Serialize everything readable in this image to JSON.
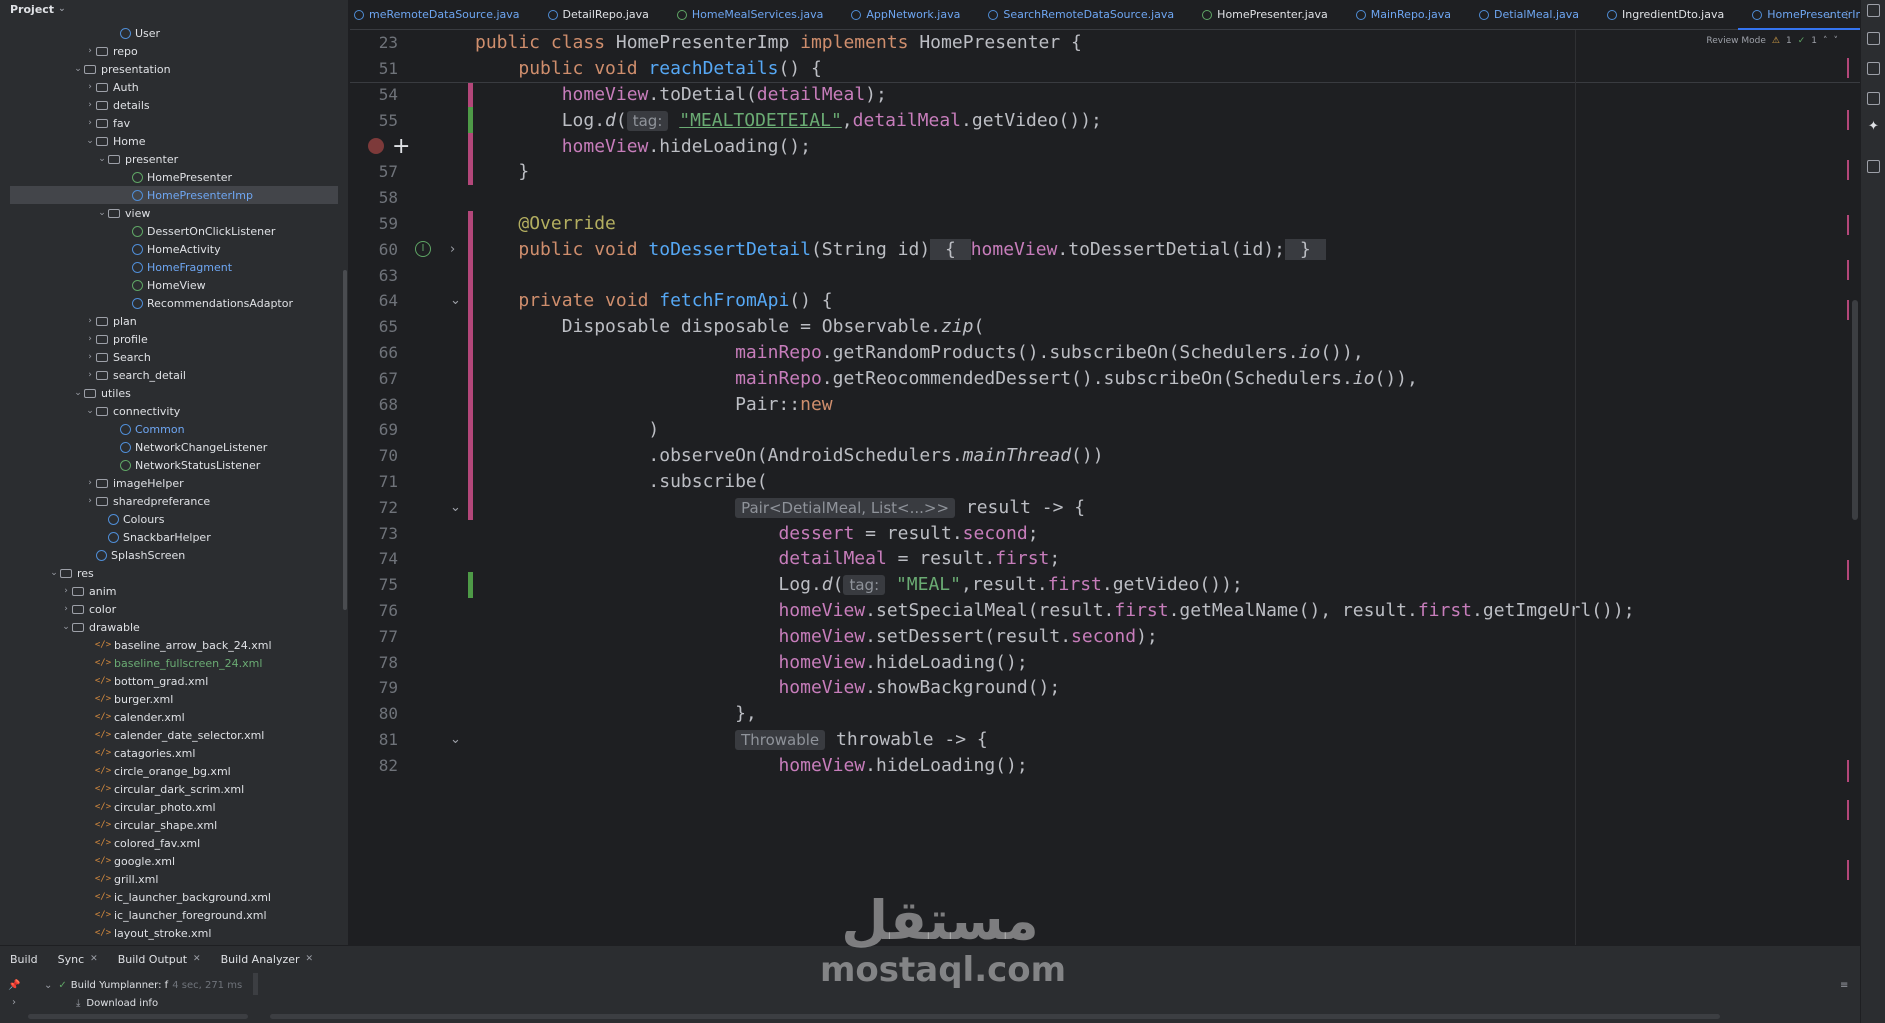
{
  "project_panel": {
    "title": "Project",
    "tree": [
      {
        "label": "User",
        "depth": 9,
        "icon": "class-icon",
        "color": "",
        "arrow": ""
      },
      {
        "label": "repo",
        "depth": 7,
        "icon": "folder-icon",
        "color": "",
        "arrow": "right"
      },
      {
        "label": "presentation",
        "depth": 6,
        "icon": "folder-icon",
        "color": "",
        "arrow": "down"
      },
      {
        "label": "Auth",
        "depth": 7,
        "icon": "folder-icon",
        "color": "",
        "arrow": "right"
      },
      {
        "label": "details",
        "depth": 7,
        "icon": "folder-icon",
        "color": "",
        "arrow": "right"
      },
      {
        "label": "fav",
        "depth": 7,
        "icon": "folder-icon",
        "color": "",
        "arrow": "right"
      },
      {
        "label": "Home",
        "depth": 7,
        "icon": "folder-icon",
        "color": "",
        "arrow": "down"
      },
      {
        "label": "presenter",
        "depth": 8,
        "icon": "folder-icon",
        "color": "",
        "arrow": "down"
      },
      {
        "label": "HomePresenter",
        "depth": 10,
        "icon": "interface-icon",
        "color": "",
        "arrow": ""
      },
      {
        "label": "HomePresenterImp",
        "depth": 10,
        "icon": "class-icon",
        "color": "blue",
        "arrow": "",
        "selected": true
      },
      {
        "label": "view",
        "depth": 8,
        "icon": "folder-icon",
        "color": "",
        "arrow": "down"
      },
      {
        "label": "DessertOnClickListener",
        "depth": 10,
        "icon": "interface-icon",
        "color": "",
        "arrow": ""
      },
      {
        "label": "HomeActivity",
        "depth": 10,
        "icon": "class-icon",
        "color": "",
        "arrow": ""
      },
      {
        "label": "HomeFragment",
        "depth": 10,
        "icon": "class-icon",
        "color": "blue",
        "arrow": ""
      },
      {
        "label": "HomeView",
        "depth": 10,
        "icon": "interface-icon",
        "color": "",
        "arrow": ""
      },
      {
        "label": "RecommendationsAdaptor",
        "depth": 10,
        "icon": "class-icon",
        "color": "",
        "arrow": ""
      },
      {
        "label": "plan",
        "depth": 7,
        "icon": "folder-icon",
        "color": "",
        "arrow": "right"
      },
      {
        "label": "profile",
        "depth": 7,
        "icon": "folder-icon",
        "color": "",
        "arrow": "right"
      },
      {
        "label": "Search",
        "depth": 7,
        "icon": "folder-icon",
        "color": "",
        "arrow": "right"
      },
      {
        "label": "search_detail",
        "depth": 7,
        "icon": "folder-icon",
        "color": "",
        "arrow": "right"
      },
      {
        "label": "utiles",
        "depth": 6,
        "icon": "folder-icon",
        "color": "",
        "arrow": "down"
      },
      {
        "label": "connectivity",
        "depth": 7,
        "icon": "folder-icon",
        "color": "",
        "arrow": "down"
      },
      {
        "label": "Common",
        "depth": 9,
        "icon": "class-icon",
        "color": "blue",
        "arrow": ""
      },
      {
        "label": "NetworkChangeListener",
        "depth": 9,
        "icon": "class-icon",
        "color": "",
        "arrow": ""
      },
      {
        "label": "NetworkStatusListener",
        "depth": 9,
        "icon": "interface-icon",
        "color": "",
        "arrow": ""
      },
      {
        "label": "imageHelper",
        "depth": 7,
        "icon": "folder-icon",
        "color": "",
        "arrow": "right"
      },
      {
        "label": "sharedpreferance",
        "depth": 7,
        "icon": "folder-icon",
        "color": "",
        "arrow": "right"
      },
      {
        "label": "Colours",
        "depth": 8,
        "icon": "class-icon",
        "color": "",
        "arrow": ""
      },
      {
        "label": "SnackbarHelper",
        "depth": 8,
        "icon": "class-icon",
        "color": "",
        "arrow": ""
      },
      {
        "label": "SplashScreen",
        "depth": 7,
        "icon": "class-icon",
        "color": "",
        "arrow": ""
      },
      {
        "label": "res",
        "depth": 4,
        "icon": "folder-icon",
        "color": "",
        "arrow": "down"
      },
      {
        "label": "anim",
        "depth": 5,
        "icon": "folder-icon",
        "color": "",
        "arrow": "right"
      },
      {
        "label": "color",
        "depth": 5,
        "icon": "folder-icon",
        "color": "",
        "arrow": "right"
      },
      {
        "label": "drawable",
        "depth": 5,
        "icon": "folder-icon",
        "color": "",
        "arrow": "down"
      },
      {
        "label": "baseline_arrow_back_24.xml",
        "depth": 7,
        "icon": "xml-icon",
        "color": "",
        "arrow": ""
      },
      {
        "label": "baseline_fullscreen_24.xml",
        "depth": 7,
        "icon": "xml-icon",
        "color": "green",
        "arrow": ""
      },
      {
        "label": "bottom_grad.xml",
        "depth": 7,
        "icon": "xml-icon",
        "color": "",
        "arrow": ""
      },
      {
        "label": "burger.xml",
        "depth": 7,
        "icon": "xml-icon",
        "color": "",
        "arrow": ""
      },
      {
        "label": "calender.xml",
        "depth": 7,
        "icon": "xml-icon",
        "color": "",
        "arrow": ""
      },
      {
        "label": "calender_date_selector.xml",
        "depth": 7,
        "icon": "xml-icon",
        "color": "",
        "arrow": ""
      },
      {
        "label": "catagories.xml",
        "depth": 7,
        "icon": "xml-icon",
        "color": "",
        "arrow": ""
      },
      {
        "label": "circle_orange_bg.xml",
        "depth": 7,
        "icon": "xml-icon",
        "color": "",
        "arrow": ""
      },
      {
        "label": "circular_dark_scrim.xml",
        "depth": 7,
        "icon": "xml-icon",
        "color": "",
        "arrow": ""
      },
      {
        "label": "circular_photo.xml",
        "depth": 7,
        "icon": "xml-icon",
        "color": "",
        "arrow": ""
      },
      {
        "label": "circular_shape.xml",
        "depth": 7,
        "icon": "xml-icon",
        "color": "",
        "arrow": ""
      },
      {
        "label": "colored_fav.xml",
        "depth": 7,
        "icon": "xml-icon",
        "color": "",
        "arrow": ""
      },
      {
        "label": "google.xml",
        "depth": 7,
        "icon": "xml-icon",
        "color": "",
        "arrow": ""
      },
      {
        "label": "grill.xml",
        "depth": 7,
        "icon": "xml-icon",
        "color": "",
        "arrow": ""
      },
      {
        "label": "ic_launcher_background.xml",
        "depth": 7,
        "icon": "xml-icon",
        "color": "",
        "arrow": ""
      },
      {
        "label": "ic_launcher_foreground.xml",
        "depth": 7,
        "icon": "xml-icon",
        "color": "",
        "arrow": ""
      },
      {
        "label": "layout_stroke.xml",
        "depth": 7,
        "icon": "xml-icon",
        "color": "",
        "arrow": ""
      }
    ]
  },
  "editor": {
    "tabs": [
      {
        "label": "meRemoteDataSource.java",
        "kind": "class",
        "color": "blue"
      },
      {
        "label": "DetailRepo.java",
        "kind": "class",
        "color": "plain"
      },
      {
        "label": "HomeMealServices.java",
        "kind": "interface",
        "color": "blue"
      },
      {
        "label": "AppNetwork.java",
        "kind": "class",
        "color": "blue"
      },
      {
        "label": "SearchRemoteDataSource.java",
        "kind": "class",
        "color": "blue"
      },
      {
        "label": "HomePresenter.java",
        "kind": "interface",
        "color": "plain"
      },
      {
        "label": "MainRepo.java",
        "kind": "class",
        "color": "blue"
      },
      {
        "label": "DetialMeal.java",
        "kind": "class",
        "color": "blue"
      },
      {
        "label": "IngredientDto.java",
        "kind": "class",
        "color": "plain"
      },
      {
        "label": "HomePresenterImp.java",
        "kind": "class",
        "color": "blue",
        "active": true
      }
    ],
    "review_mode_label": "Review Mode",
    "warning_count": "1",
    "ok_count": "1",
    "lines": [
      {
        "n": "23",
        "sticky": true,
        "tokens": [
          [
            "kw",
            "public class "
          ],
          [
            "",
            "HomePresenterImp "
          ],
          [
            "kw",
            "implements "
          ],
          [
            "",
            "HomePresenter {"
          ]
        ]
      },
      {
        "n": "51",
        "sticky": true,
        "tokens": [
          [
            "",
            "    "
          ],
          [
            "kw",
            "public void "
          ],
          [
            "fn",
            "reachDetails"
          ],
          [
            "",
            "() {"
          ]
        ]
      },
      {
        "n": "54",
        "bar": "pink",
        "tokens": [
          [
            "",
            "        "
          ],
          [
            "fld",
            "homeView"
          ],
          [
            "",
            ".toDetial("
          ],
          [
            "fld",
            "detailMeal"
          ],
          [
            "",
            ");"
          ]
        ]
      },
      {
        "n": "55",
        "bar": "green",
        "tokens": [
          [
            "",
            "        Log."
          ],
          [
            "it",
            "d"
          ],
          [
            "",
            "("
          ],
          [
            "hint",
            "tag:"
          ],
          [
            "str",
            " "
          ],
          [
            "str ul",
            "\"MEALTODETEIAL\""
          ],
          [
            "",
            ","
          ],
          [
            "fld",
            "detailMeal"
          ],
          [
            "",
            ".getVideo());"
          ]
        ]
      },
      {
        "n": "",
        "bar": "pink",
        "breakpoint": true,
        "tokens": [
          [
            "",
            "        "
          ],
          [
            "fld",
            "homeView"
          ],
          [
            "",
            ".hideLoading();"
          ]
        ]
      },
      {
        "n": "57",
        "bar": "pink",
        "tokens": [
          [
            "",
            "    }"
          ]
        ]
      },
      {
        "n": "58",
        "tokens": [
          [
            "",
            ""
          ]
        ]
      },
      {
        "n": "59",
        "bar": "pink",
        "tokens": [
          [
            "",
            "    "
          ],
          [
            "ann",
            "@Override"
          ]
        ]
      },
      {
        "n": "60",
        "bar": "pink",
        "override": true,
        "fold": "›",
        "tokens": [
          [
            "",
            "    "
          ],
          [
            "kw",
            "public void "
          ],
          [
            "fn",
            "toDessertDetail"
          ],
          [
            "",
            "(String id)"
          ],
          [
            "fold-box",
            " { "
          ],
          [
            "fld",
            "homeView"
          ],
          [
            "",
            ".toDessertDetial(id);"
          ],
          [
            "fold-box",
            " } "
          ]
        ]
      },
      {
        "n": "63",
        "bar": "pink",
        "tokens": [
          [
            "",
            ""
          ]
        ]
      },
      {
        "n": "64",
        "bar": "pink",
        "fold": "⌄",
        "tokens": [
          [
            "",
            "    "
          ],
          [
            "kw",
            "private void "
          ],
          [
            "fn",
            "fetchFromApi"
          ],
          [
            "",
            "() {"
          ]
        ]
      },
      {
        "n": "65",
        "bar": "pink",
        "tokens": [
          [
            "",
            "        Disposable disposable = Observable."
          ],
          [
            "it",
            "zip"
          ],
          [
            "",
            "("
          ]
        ]
      },
      {
        "n": "66",
        "bar": "pink",
        "tokens": [
          [
            "",
            "                        "
          ],
          [
            "fld",
            "mainRepo"
          ],
          [
            "",
            ".getRandomProducts().subscribeOn(Schedulers."
          ],
          [
            "it",
            "io"
          ],
          [
            "",
            "()),"
          ]
        ]
      },
      {
        "n": "67",
        "bar": "pink",
        "tokens": [
          [
            "",
            "                        "
          ],
          [
            "fld",
            "mainRepo"
          ],
          [
            "",
            ".getReocommendedDessert().subscribeOn(Schedulers."
          ],
          [
            "it",
            "io"
          ],
          [
            "",
            "()),"
          ]
        ]
      },
      {
        "n": "68",
        "bar": "pink",
        "tokens": [
          [
            "",
            "                        Pair::"
          ],
          [
            "kw",
            "new"
          ]
        ]
      },
      {
        "n": "69",
        "bar": "pink",
        "tokens": [
          [
            "",
            "                )"
          ]
        ]
      },
      {
        "n": "70",
        "bar": "pink",
        "tokens": [
          [
            "",
            "                .observeOn(AndroidSchedulers."
          ],
          [
            "it",
            "mainThread"
          ],
          [
            "",
            "())"
          ]
        ]
      },
      {
        "n": "71",
        "bar": "pink",
        "tokens": [
          [
            "",
            "                .subscribe("
          ]
        ]
      },
      {
        "n": "72",
        "bar": "pink",
        "fold": "⌄",
        "tokens": [
          [
            "",
            "                        "
          ],
          [
            "hint",
            "Pair<DetialMeal, List<...>>"
          ],
          [
            "",
            " result -> {"
          ]
        ]
      },
      {
        "n": "73",
        "tokens": [
          [
            "",
            "                            "
          ],
          [
            "fld",
            "dessert"
          ],
          [
            "",
            " = result."
          ],
          [
            "fld",
            "second"
          ],
          [
            "",
            ";"
          ]
        ]
      },
      {
        "n": "74",
        "tokens": [
          [
            "",
            "                            "
          ],
          [
            "fld",
            "detailMeal"
          ],
          [
            "",
            " = result."
          ],
          [
            "fld",
            "first"
          ],
          [
            "",
            ";"
          ]
        ]
      },
      {
        "n": "75",
        "bar": "green",
        "tokens": [
          [
            "",
            "                            Log."
          ],
          [
            "it",
            "d"
          ],
          [
            "",
            "("
          ],
          [
            "hint",
            "tag:"
          ],
          [
            "str",
            " \"MEAL\""
          ],
          [
            "",
            ",result."
          ],
          [
            "fld",
            "first"
          ],
          [
            "",
            ".getVideo());"
          ]
        ]
      },
      {
        "n": "76",
        "tokens": [
          [
            "",
            "                            "
          ],
          [
            "fld",
            "homeView"
          ],
          [
            "",
            ".setSpecialMeal(result."
          ],
          [
            "fld",
            "first"
          ],
          [
            "",
            ".getMealName(), result."
          ],
          [
            "fld",
            "first"
          ],
          [
            "",
            ".getImgeUrl());"
          ]
        ]
      },
      {
        "n": "77",
        "tokens": [
          [
            "",
            "                            "
          ],
          [
            "fld",
            "homeView"
          ],
          [
            "",
            ".setDessert(result."
          ],
          [
            "fld",
            "second"
          ],
          [
            "",
            ");"
          ]
        ]
      },
      {
        "n": "78",
        "tokens": [
          [
            "",
            "                            "
          ],
          [
            "fld",
            "homeView"
          ],
          [
            "",
            ".hideLoading();"
          ]
        ]
      },
      {
        "n": "79",
        "tokens": [
          [
            "",
            "                            "
          ],
          [
            "fld",
            "homeView"
          ],
          [
            "",
            ".showBackground();"
          ]
        ]
      },
      {
        "n": "80",
        "tokens": [
          [
            "",
            "                        },"
          ]
        ]
      },
      {
        "n": "81",
        "fold": "⌄",
        "tokens": [
          [
            "",
            "                        "
          ],
          [
            "hint",
            "Throwable"
          ],
          [
            "",
            " throwable -> {"
          ]
        ]
      },
      {
        "n": "82",
        "tokens": [
          [
            "",
            "                            "
          ],
          [
            "fld",
            "homeView"
          ],
          [
            "",
            ".hideLoading();"
          ]
        ]
      }
    ]
  },
  "build_panel": {
    "tabs": [
      {
        "label": "Build",
        "closable": false
      },
      {
        "label": "Sync",
        "closable": true
      },
      {
        "label": "Build Output",
        "closable": true
      },
      {
        "label": "Build Analyzer",
        "closable": true
      }
    ],
    "build_row_label": "Build Yumplanner: f",
    "build_row_time": "4 sec, 271 ms",
    "download_label": "Download info"
  },
  "watermark": {
    "arabic": "مستقل",
    "latin": "mostaql.com"
  },
  "colors": {
    "accent": "#3574f0",
    "keyword": "#cf8e6d",
    "function": "#56a8f5",
    "field": "#c77dbb",
    "string": "#6aab73",
    "annotation": "#b3ae60"
  }
}
